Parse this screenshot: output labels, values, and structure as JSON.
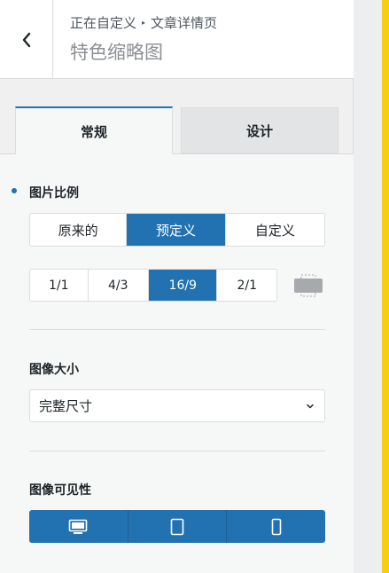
{
  "header": {
    "breadcrumb_prefix": "正在自定义",
    "breadcrumb_current": "文章详情页",
    "title": "特色缩略图"
  },
  "tabs": [
    {
      "label": "常规",
      "active": true
    },
    {
      "label": "设计",
      "active": false
    }
  ],
  "image_ratio": {
    "label": "图片比例",
    "modes": [
      "原来的",
      "预定义",
      "自定义"
    ],
    "selected_mode": "预定义",
    "ratios": [
      "1/1",
      "4/3",
      "16/9",
      "2/1"
    ],
    "selected_ratio": "16/9"
  },
  "image_size": {
    "label": "图像大小",
    "value": "完整尺寸"
  },
  "visibility": {
    "label": "图像可见性",
    "devices": [
      "desktop-icon",
      "tablet-icon",
      "mobile-icon"
    ]
  },
  "colors": {
    "accent": "#2271b1",
    "highlight": "#f5d010"
  }
}
